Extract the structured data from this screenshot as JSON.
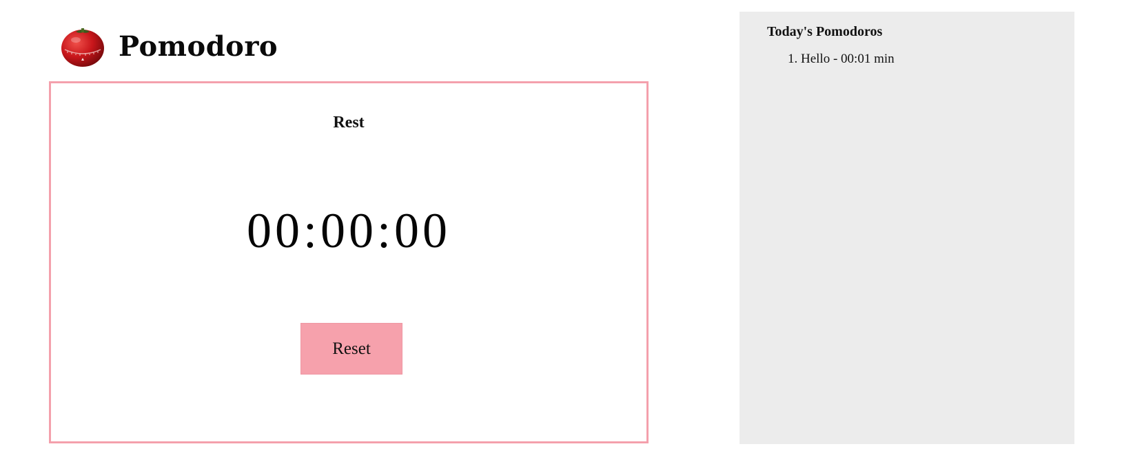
{
  "app": {
    "title": "Pomodoro",
    "logo_icon": "tomato-timer-icon"
  },
  "timer": {
    "mode": "Rest",
    "time": "00:00:00",
    "reset_label": "Reset"
  },
  "sidebar": {
    "title": "Today's Pomodoros",
    "items": [
      {
        "number": "1.",
        "text": "Hello - 00:01 min"
      }
    ]
  },
  "colors": {
    "accent_pink": "#f6a1ac",
    "card_border": "#f4a0ac",
    "sidebar_bg": "#ececec",
    "tomato_red": "#c8161b"
  }
}
